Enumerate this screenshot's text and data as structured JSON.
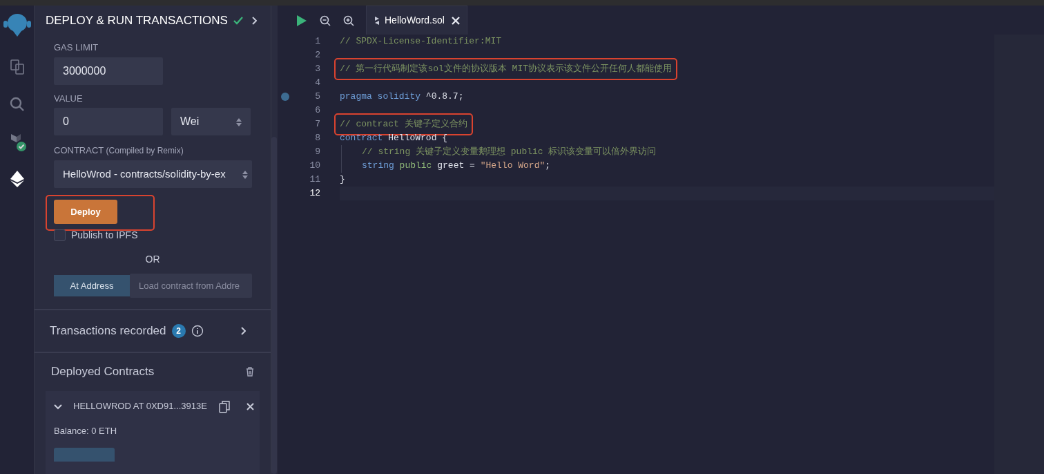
{
  "icon_bar": {
    "items": [
      {
        "kind": "logo",
        "selected": false
      },
      {
        "kind": "files",
        "selected": false
      },
      {
        "kind": "search",
        "selected": false
      },
      {
        "kind": "compiler",
        "selected": false
      },
      {
        "kind": "deploy",
        "selected": true
      }
    ]
  },
  "panel": {
    "title": "DEPLOY & RUN TRANSACTIONS",
    "title_checked": true,
    "gas_limit": {
      "label": "GAS LIMIT",
      "value": "3000000"
    },
    "value": {
      "label": "VALUE",
      "value": "0",
      "unit": "Wei"
    },
    "contract": {
      "label": "CONTRACT",
      "note": "(Compiled by Remix)",
      "value": "HelloWrod - contracts/solidity-by-ex"
    },
    "deploy_button": "Deploy",
    "deploy_highlighted": true,
    "publish": {
      "label": "Publish to IPFS",
      "checked": false
    },
    "or": "OR",
    "at_address": {
      "button": "At Address",
      "placeholder": "Load contract from Addre"
    },
    "transactions": {
      "label": "Transactions recorded",
      "count": "2"
    },
    "deployed": {
      "title": "Deployed Contracts",
      "items": [
        {
          "name": "HELLOWROD AT 0XD91...3913E",
          "expanded": true,
          "balance": "Balance: 0 ETH"
        }
      ]
    }
  },
  "editor": {
    "tabs": [
      {
        "label": "HelloWord.sol",
        "selected": true
      }
    ],
    "lines": [
      {
        "number": "1",
        "tokens": [
          {
            "kind": "comment",
            "text": "// SPDX-License-Identifier:MIT"
          }
        ]
      },
      {
        "number": "2"
      },
      {
        "number": "3",
        "highlighted": true,
        "tokens": [
          {
            "kind": "comment",
            "text": "// 第一行代码制定该sol文件的协议版本 MIT协议表示该文件公开任何人都能使用"
          }
        ]
      },
      {
        "number": "4"
      },
      {
        "number": "5",
        "breakpoint": true,
        "tokens": [
          {
            "kind": "keyword",
            "text": "pragma"
          },
          {
            "kind": "keyword",
            "text": " solidity"
          },
          {
            "kind": "plain",
            "text": " ^0.8.7;"
          }
        ]
      },
      {
        "number": "6"
      },
      {
        "number": "7",
        "highlighted": true,
        "tokens": [
          {
            "kind": "comment",
            "text": "// contract 关键子定义合约"
          }
        ]
      },
      {
        "number": "8",
        "tokens": [
          {
            "kind": "keyword",
            "text": "contract"
          },
          {
            "kind": "plain",
            "text": " HelloWrod {"
          }
        ]
      },
      {
        "number": "9",
        "indent": true,
        "tokens": [
          {
            "kind": "comment",
            "text": "// string 关键子定义变量鹅理想 public 标识该变量可以倍外界访问"
          }
        ]
      },
      {
        "number": "10",
        "indent": true,
        "tokens": [
          {
            "kind": "keyword",
            "text": "string"
          },
          {
            "kind": "type",
            "text": " public"
          },
          {
            "kind": "plain",
            "text": " greet = "
          },
          {
            "kind": "string",
            "text": "\"Hello Word\""
          },
          {
            "kind": "plain",
            "text": ";"
          }
        ]
      },
      {
        "number": "11",
        "tokens": [
          {
            "kind": "plain",
            "text": "}"
          }
        ]
      },
      {
        "number": "12",
        "current": true
      }
    ]
  }
}
